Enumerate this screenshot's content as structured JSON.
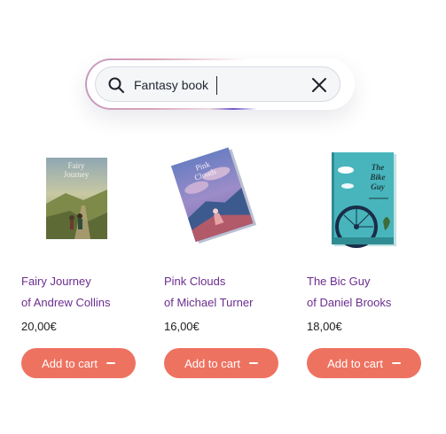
{
  "search": {
    "value": "Fantasy book",
    "icon": "search-icon",
    "clear_icon": "close-icon"
  },
  "products": [
    {
      "cover_title": "Fairy Journey",
      "title": "Fairy Journey",
      "author_prefix": "of",
      "author": "Andrew Collins",
      "price": "20,00€",
      "button_label": "Add to cart"
    },
    {
      "cover_title": "Pink Clouds",
      "title": "Pink Clouds",
      "author_prefix": "of",
      "author": "Michael Turner",
      "price": "16,00€",
      "button_label": "Add to cart"
    },
    {
      "cover_title": "The Bike Guy",
      "title": "The Bic Guy",
      "author_prefix": "of",
      "author": "Daniel Brooks",
      "price": "18,00€",
      "button_label": "Add to cart"
    }
  ],
  "colors": {
    "accent": "#ee7260",
    "title_text": "#6b2e8f",
    "search_bg": "#f4f6f8"
  }
}
